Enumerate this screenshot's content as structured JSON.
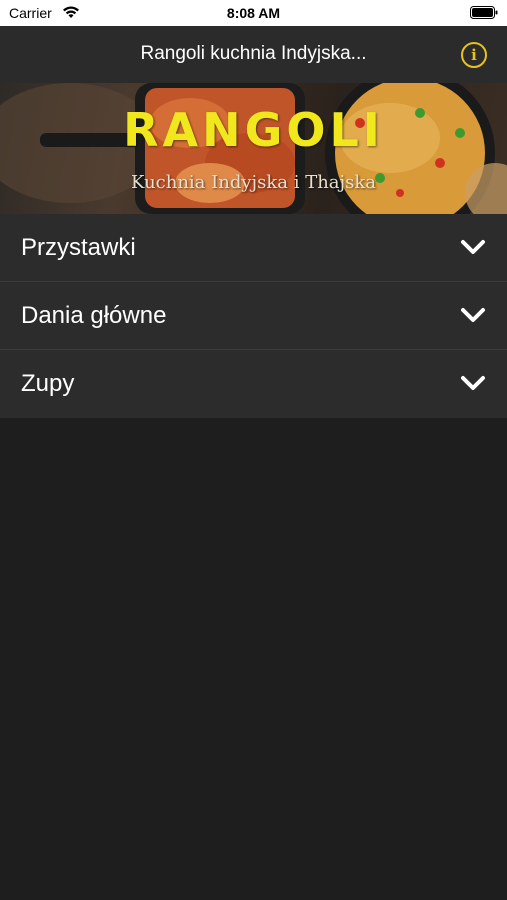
{
  "status_bar": {
    "carrier": "Carrier",
    "time": "8:08 AM"
  },
  "nav": {
    "title": "Rangoli kuchnia Indyjska...",
    "info_icon": "info-circle-icon",
    "accent_color": "#e6c21c"
  },
  "banner": {
    "logo_text": "RANGOLI",
    "tagline": "Kuchnia Indyjska i Thajska"
  },
  "menu": {
    "items": [
      {
        "label": "Przystawki"
      },
      {
        "label": "Dania główne"
      },
      {
        "label": "Zupy"
      }
    ],
    "chevron_icon": "chevron-down-icon"
  }
}
